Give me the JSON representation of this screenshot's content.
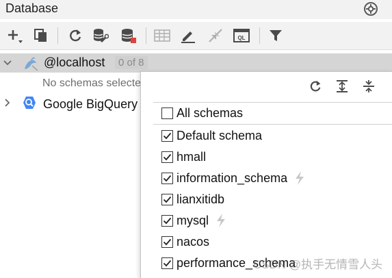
{
  "panel": {
    "title": "Database"
  },
  "toolbar": {
    "buttons": [
      {
        "name": "add",
        "icon": "plus-icon"
      },
      {
        "name": "duplicate",
        "icon": "copy-icon"
      },
      {
        "name": "refresh",
        "icon": "refresh-icon"
      },
      {
        "name": "datasource-properties",
        "icon": "database-wrench-icon"
      },
      {
        "name": "database-stop",
        "icon": "database-stop-icon"
      },
      {
        "name": "table-view",
        "icon": "table-icon"
      },
      {
        "name": "edit",
        "icon": "pencil-icon"
      },
      {
        "name": "jump",
        "icon": "arrow-jump-icon"
      },
      {
        "name": "query-console",
        "icon": "ql-console-icon"
      },
      {
        "name": "filter",
        "icon": "filter-icon"
      }
    ]
  },
  "tree": {
    "localhost": {
      "label": "@localhost",
      "count": "0 of 8"
    },
    "no_schemas": "No schemas selecte",
    "bigquery": {
      "label": "Google BigQuery"
    }
  },
  "popup": {
    "all_schemas": {
      "label": "All schemas",
      "checked": false
    },
    "options": [
      {
        "label": "Default schema",
        "checked": true,
        "bolt": false
      },
      {
        "label": "hmall",
        "checked": true,
        "bolt": false
      },
      {
        "label": "information_schema",
        "checked": true,
        "bolt": true
      },
      {
        "label": "lianxitidb",
        "checked": true,
        "bolt": false
      },
      {
        "label": "mysql",
        "checked": true,
        "bolt": true
      },
      {
        "label": "nacos",
        "checked": true,
        "bolt": false
      },
      {
        "label": "performance_schema",
        "checked": true,
        "bolt": false
      }
    ]
  },
  "watermark": "CSDN @执手无情雪人头",
  "colors": {
    "accent_red": "#e2403e",
    "icon_gray": "#5a5a5a",
    "bigquery_blue": "#4285f4"
  }
}
